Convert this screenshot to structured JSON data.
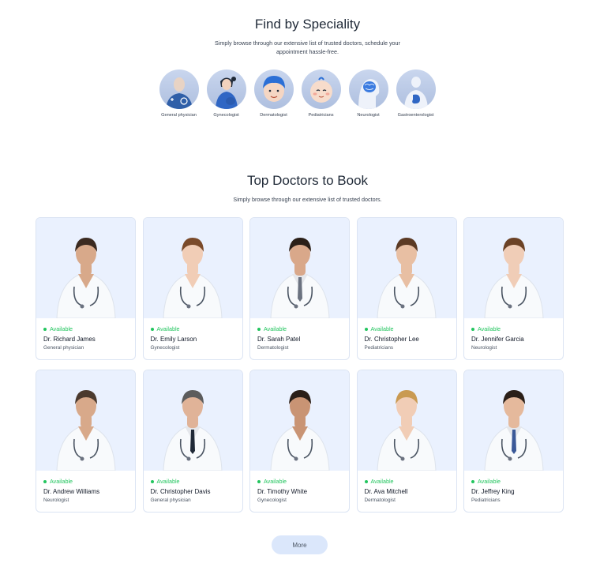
{
  "speciality": {
    "title": "Find by Speciality",
    "subtitle_line1": "Simply browse through our extensive list of trusted doctors, schedule your",
    "subtitle_line2": "appointment hassle-free.",
    "items": [
      {
        "label": "General physician",
        "icon": "general-physician-icon"
      },
      {
        "label": "Gynecologist",
        "icon": "gynecologist-icon"
      },
      {
        "label": "Dermatologist",
        "icon": "dermatologist-icon"
      },
      {
        "label": "Pediatricians",
        "icon": "pediatrician-icon"
      },
      {
        "label": "Neurologist",
        "icon": "neurologist-icon"
      },
      {
        "label": "Gastroenterologist",
        "icon": "gastroenterologist-icon"
      }
    ]
  },
  "top_doctors": {
    "title": "Top Doctors to Book",
    "subtitle": "Simply browse through our extensive list of trusted doctors.",
    "availability_label": "Available",
    "doctors": [
      {
        "name": "Dr. Richard James",
        "speciality": "General physician"
      },
      {
        "name": "Dr. Emily Larson",
        "speciality": "Gynecologist"
      },
      {
        "name": "Dr. Sarah Patel",
        "speciality": "Dermatologist"
      },
      {
        "name": "Dr. Christopher Lee",
        "speciality": "Pediatricians"
      },
      {
        "name": "Dr. Jennifer Garcia",
        "speciality": "Neurologist"
      },
      {
        "name": "Dr. Andrew Williams",
        "speciality": "Neurologist"
      },
      {
        "name": "Dr. Christopher Davis",
        "speciality": "General physician"
      },
      {
        "name": "Dr. Timothy White",
        "speciality": "Gynecologist"
      },
      {
        "name": "Dr. Ava Mitchell",
        "speciality": "Dermatologist"
      },
      {
        "name": "Dr. Jeffrey King",
        "speciality": "Pediatricians"
      }
    ]
  },
  "more_button": "More",
  "colors": {
    "available_green": "#22c55e",
    "card_photo_bg": "#eaf1fe",
    "button_bg": "#dbe7fb"
  }
}
